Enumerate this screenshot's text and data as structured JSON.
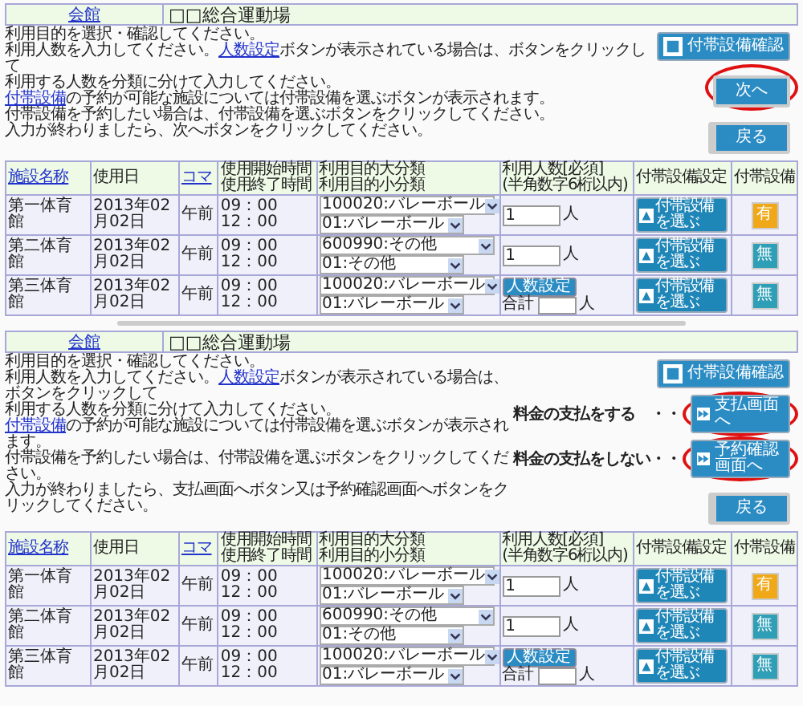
{
  "panels": [
    {
      "venue_link": "会館",
      "venue_name": "□□総合運動場",
      "instructions": [
        [
          {
            "text": "利用目的を選択・確認してください。"
          }
        ],
        [
          {
            "text": "利用人数を入力してください。"
          },
          {
            "link": "人数設定"
          },
          {
            "text": "ボタンが表示されている場合は、ボタンをクリックして"
          }
        ],
        [
          {
            "text": "利用する人数を分類に分けて入力してください。"
          }
        ],
        [
          {
            "link": "付帯設備"
          },
          {
            "text": "の予約が可能な施設については付帯設備を選ぶボタンが表示されます。"
          }
        ],
        [
          {
            "text": "付帯設備を予約したい場合は、付帯設備を選ぶボタンをクリックしてください。"
          }
        ],
        [
          {
            "text": "入力が終わりましたら、次へボタンをクリックしてください。"
          }
        ]
      ],
      "buttons": [
        {
          "kind": "check",
          "label": "付帯設備確認",
          "highlighted": false
        },
        {
          "kind": "next",
          "label": "次へ",
          "highlighted": true
        },
        {
          "kind": "back",
          "label": "戻る",
          "highlighted": false
        }
      ],
      "table": {
        "columns": [
          {
            "lines": [
              "施設名称"
            ],
            "link": true
          },
          {
            "lines": [
              "使用日"
            ],
            "link": false
          },
          {
            "lines": [
              "コマ"
            ],
            "link": true
          },
          {
            "lines": [
              "使用開始時間",
              "使用終了時間"
            ],
            "link": false
          },
          {
            "lines": [
              "利用目的大分類",
              "利用目的小分類"
            ],
            "link": false
          },
          {
            "lines": [
              "利用人数[必須]",
              "(半角数字6桁以内)"
            ],
            "link": false
          },
          {
            "lines": [
              "付帯設備設定"
            ],
            "link": false
          },
          {
            "lines": [
              "付帯設備"
            ],
            "link": false
          }
        ],
        "rows": [
          {
            "facility": "第一体育館",
            "date": "2013年02月02日",
            "slot": "午前",
            "start": "09：00",
            "end": "12：00",
            "purpose_major": "100020:バレーボール",
            "purpose_minor": "01:バレーボール",
            "people": {
              "kind": "input",
              "value": "1",
              "unit": "人"
            },
            "equipment_button": "付帯設備を選ぶ",
            "equipment": {
              "label": "有",
              "color": "#f0a818"
            }
          },
          {
            "facility": "第二体育館",
            "date": "2013年02月02日",
            "slot": "午前",
            "start": "09：00",
            "end": "12：00",
            "purpose_major": "600990:その他",
            "purpose_minor": "01:その他",
            "people": {
              "kind": "input",
              "value": "1",
              "unit": "人"
            },
            "equipment_button": "付帯設備を選ぶ",
            "equipment": {
              "label": "無",
              "color": "#2f9fb8"
            }
          },
          {
            "facility": "第三体育館",
            "date": "2013年02月02日",
            "slot": "午前",
            "start": "09：00",
            "end": "12：00",
            "purpose_major": "100020:バレーボール",
            "purpose_minor": "01:バレーボール",
            "people": {
              "kind": "group",
              "button": "人数設定",
              "total_label": "合計",
              "unit": "人"
            },
            "equipment_button": "付帯設備を選ぶ",
            "equipment": {
              "label": "無",
              "color": "#2f9fb8"
            }
          }
        ]
      }
    },
    {
      "venue_link": "会館",
      "venue_name": "□□総合運動場",
      "instructions": [
        [
          {
            "text": "利用目的を選択・確認してください。"
          }
        ],
        [
          {
            "text": "利用人数を入力してください。"
          },
          {
            "link": "人数設定"
          },
          {
            "text": "ボタンが表示されている場合は、ボタンをクリックして"
          }
        ],
        [
          {
            "text": "利用する人数を分類に分けて入力してください。"
          }
        ],
        [
          {
            "link": "付帯設備"
          },
          {
            "text": "の予約が可能な施設については付帯設備を選ぶボタンが表示されます。"
          }
        ],
        [
          {
            "text": "付帯設備を予約したい場合は、付帯設備を選ぶボタンをクリックしてください。"
          }
        ],
        [
          {
            "text": "入力が終わりましたら、支払画面へボタン又は予約確認画面へボタンをクリックしてください。"
          }
        ]
      ],
      "buttons": [
        {
          "kind": "check",
          "label": "付帯設備確認",
          "highlighted": false
        },
        {
          "kind": "forward",
          "label": "支払画面へ",
          "note": "料金の支払をする　・・",
          "highlighted": true
        },
        {
          "kind": "forward",
          "label": "予約確認画面へ",
          "note": "料金の支払をしない・・",
          "highlighted": true
        },
        {
          "kind": "back",
          "label": "戻る",
          "highlighted": false
        }
      ],
      "table": {
        "columns": [
          {
            "lines": [
              "施設名称"
            ],
            "link": true
          },
          {
            "lines": [
              "使用日"
            ],
            "link": false
          },
          {
            "lines": [
              "コマ"
            ],
            "link": true
          },
          {
            "lines": [
              "使用開始時間",
              "使用終了時間"
            ],
            "link": false
          },
          {
            "lines": [
              "利用目的大分類",
              "利用目的小分類"
            ],
            "link": false
          },
          {
            "lines": [
              "利用人数[必須]",
              "(半角数字6桁以内)"
            ],
            "link": false
          },
          {
            "lines": [
              "付帯設備設定"
            ],
            "link": false
          },
          {
            "lines": [
              "付帯設備"
            ],
            "link": false
          }
        ],
        "rows": [
          {
            "facility": "第一体育館",
            "date": "2013年02月02日",
            "slot": "午前",
            "start": "09：00",
            "end": "12：00",
            "purpose_major": "100020:バレーボール",
            "purpose_minor": "01:バレーボール",
            "people": {
              "kind": "input",
              "value": "1",
              "unit": "人"
            },
            "equipment_button": "付帯設備を選ぶ",
            "equipment": {
              "label": "有",
              "color": "#f0a818"
            }
          },
          {
            "facility": "第二体育館",
            "date": "2013年02月02日",
            "slot": "午前",
            "start": "09：00",
            "end": "12：00",
            "purpose_major": "600990:その他",
            "purpose_minor": "01:その他",
            "people": {
              "kind": "input",
              "value": "1",
              "unit": "人"
            },
            "equipment_button": "付帯設備を選ぶ",
            "equipment": {
              "label": "無",
              "color": "#2f9fb8"
            }
          },
          {
            "facility": "第三体育館",
            "date": "2013年02月02日",
            "slot": "午前",
            "start": "09：00",
            "end": "12：00",
            "purpose_major": "100020:バレーボール",
            "purpose_minor": "01:バレーボール",
            "people": {
              "kind": "group",
              "button": "人数設定",
              "total_label": "合計",
              "unit": "人"
            },
            "equipment_button": "付帯設備を選ぶ",
            "equipment": {
              "label": "無",
              "color": "#2f9fb8"
            }
          }
        ]
      }
    }
  ]
}
